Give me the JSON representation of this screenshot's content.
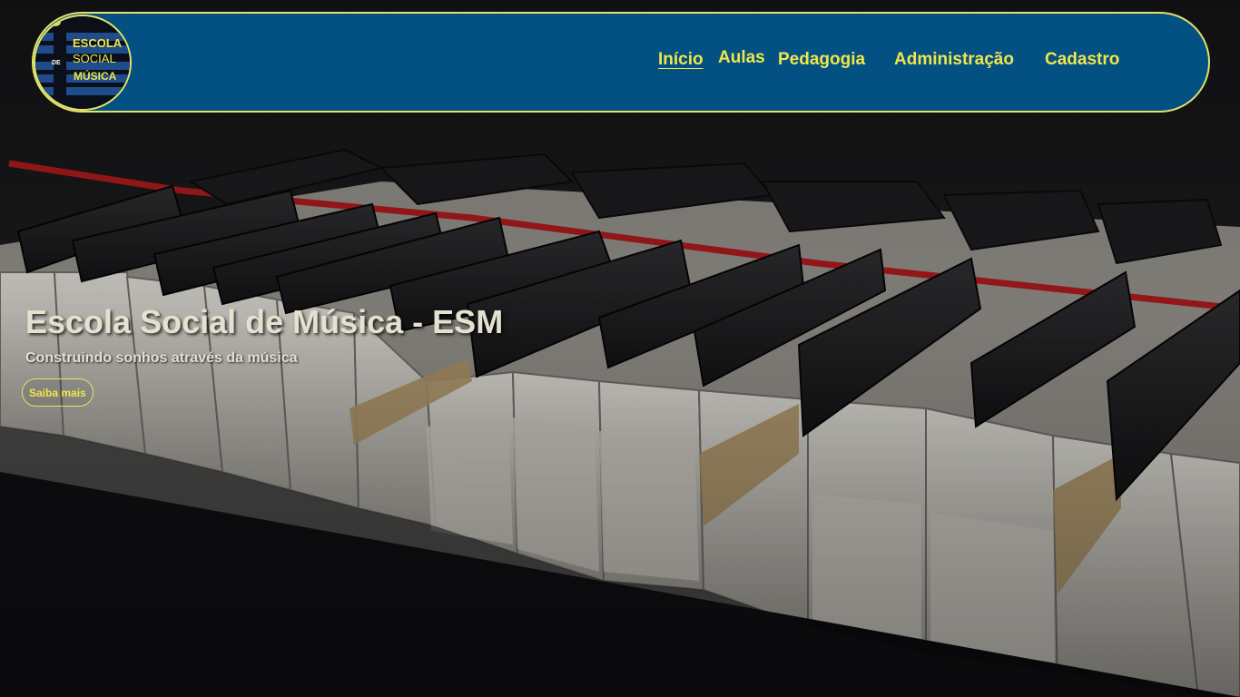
{
  "logo": {
    "line1": "ESCOLA",
    "line2_prefix": "DE",
    "line2": "SOCIAL",
    "line3": "MÚSICA",
    "icon": "guitar-icon"
  },
  "nav": {
    "items": [
      {
        "label": "Início",
        "active": true
      },
      {
        "label": "Aulas",
        "active": false
      },
      {
        "label": "Pedagogia",
        "active": false
      },
      {
        "label": "Administração",
        "active": false
      },
      {
        "label": "Cadastro",
        "active": false
      }
    ]
  },
  "hero": {
    "title": "Escola Social de Música - ESM",
    "subtitle": "Construindo sonhos através da música",
    "button_label": "Saiba mais",
    "background": "piano-keys-photo"
  },
  "colors": {
    "navbar_bg": "#035083",
    "accent_yellow": "#f0e64a",
    "border_yellow": "#e3e36a",
    "hero_text": "#e4e2cf"
  }
}
